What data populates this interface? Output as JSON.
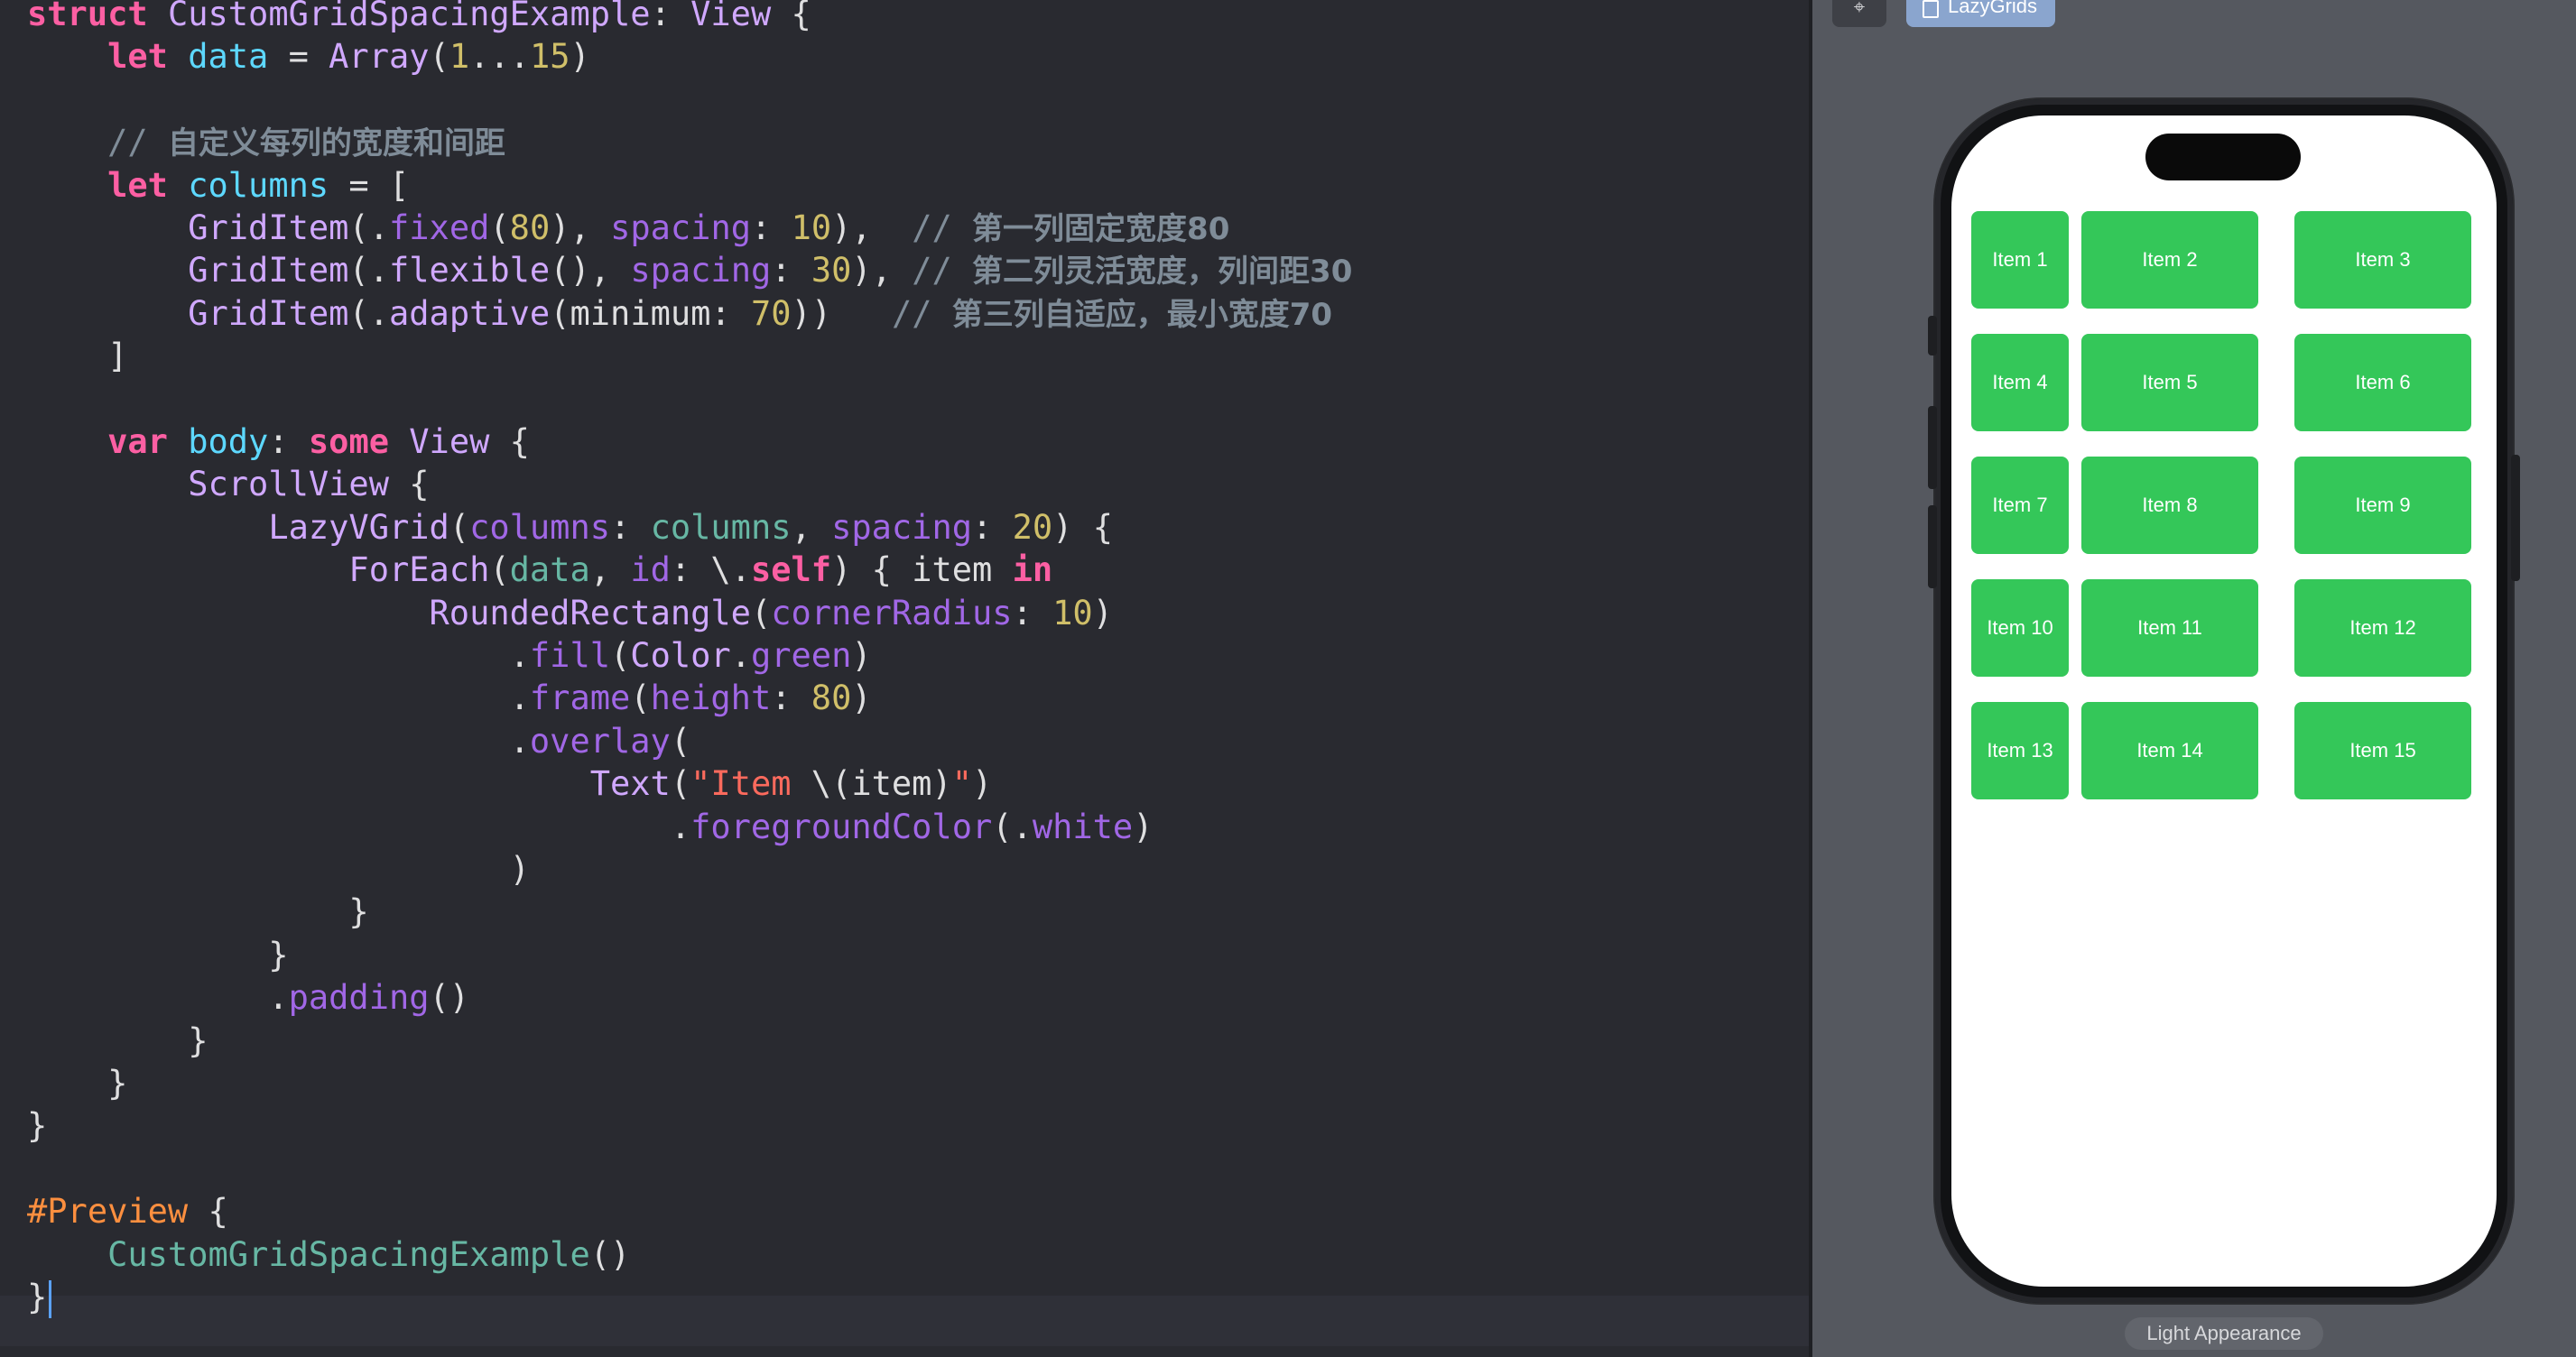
{
  "editor": {
    "lines": [
      [
        [
          "kw",
          "struct "
        ],
        [
          "type",
          "CustomGridSpacingExample"
        ],
        [
          "txt",
          ": "
        ],
        [
          "type",
          "View"
        ],
        [
          "txt",
          " {"
        ]
      ],
      [
        [
          "txt",
          "    "
        ],
        [
          "kw",
          "let "
        ],
        [
          "var",
          "data"
        ],
        [
          "txt",
          " = "
        ],
        [
          "type",
          "Array"
        ],
        [
          "txt",
          "("
        ],
        [
          "num",
          "1"
        ],
        [
          "txt",
          "..."
        ],
        [
          "num",
          "15"
        ],
        [
          "txt",
          ")"
        ]
      ],
      [],
      [
        [
          "txt",
          "    "
        ],
        [
          "cm",
          "// "
        ],
        [
          "cm cm-zh",
          "自定义每列的宽度和间距"
        ]
      ],
      [
        [
          "txt",
          "    "
        ],
        [
          "kw",
          "let "
        ],
        [
          "var",
          "columns"
        ],
        [
          "txt",
          " = ["
        ]
      ],
      [
        [
          "txt",
          "        "
        ],
        [
          "type",
          "GridItem"
        ],
        [
          "txt",
          "(."
        ],
        [
          "member",
          "fixed"
        ],
        [
          "txt",
          "("
        ],
        [
          "num",
          "80"
        ],
        [
          "txt",
          "), "
        ],
        [
          "member",
          "spacing"
        ],
        [
          "txt",
          ": "
        ],
        [
          "num",
          "10"
        ],
        [
          "txt",
          "),  "
        ],
        [
          "cm",
          "// "
        ],
        [
          "cm cm-zh",
          "第一列固定宽度80"
        ]
      ],
      [
        [
          "txt",
          "        "
        ],
        [
          "type",
          "GridItem"
        ],
        [
          "txt",
          "(."
        ],
        [
          "type",
          "flexible"
        ],
        [
          "txt",
          "(), "
        ],
        [
          "member",
          "spacing"
        ],
        [
          "txt",
          ": "
        ],
        [
          "num",
          "30"
        ],
        [
          "txt",
          "), "
        ],
        [
          "cm",
          "// "
        ],
        [
          "cm cm-zh",
          "第二列灵活宽度，列间距30"
        ]
      ],
      [
        [
          "txt",
          "        "
        ],
        [
          "type",
          "GridItem"
        ],
        [
          "txt",
          "(."
        ],
        [
          "type",
          "adaptive"
        ],
        [
          "txt",
          "(minimum: "
        ],
        [
          "num",
          "70"
        ],
        [
          "txt",
          "))   "
        ],
        [
          "cm",
          "// "
        ],
        [
          "cm cm-zh",
          "第三列自适应，最小宽度70"
        ]
      ],
      [
        [
          "txt",
          "    ]"
        ]
      ],
      [],
      [
        [
          "txt",
          "    "
        ],
        [
          "kw",
          "var "
        ],
        [
          "var",
          "body"
        ],
        [
          "txt",
          ": "
        ],
        [
          "kw",
          "some "
        ],
        [
          "type",
          "View"
        ],
        [
          "txt",
          " {"
        ]
      ],
      [
        [
          "txt",
          "        "
        ],
        [
          "type",
          "ScrollView"
        ],
        [
          "txt",
          " {"
        ]
      ],
      [
        [
          "txt",
          "            "
        ],
        [
          "type",
          "LazyVGrid"
        ],
        [
          "txt",
          "("
        ],
        [
          "member",
          "columns"
        ],
        [
          "txt",
          ": "
        ],
        [
          "prj",
          "columns"
        ],
        [
          "txt",
          ", "
        ],
        [
          "member",
          "spacing"
        ],
        [
          "txt",
          ": "
        ],
        [
          "num",
          "20"
        ],
        [
          "txt",
          ") {"
        ]
      ],
      [
        [
          "txt",
          "                "
        ],
        [
          "type",
          "ForEach"
        ],
        [
          "txt",
          "("
        ],
        [
          "prj",
          "data"
        ],
        [
          "txt",
          ", "
        ],
        [
          "member",
          "id"
        ],
        [
          "txt",
          ": \\."
        ],
        [
          "kw",
          "self"
        ],
        [
          "txt",
          ") { item "
        ],
        [
          "kw",
          "in"
        ]
      ],
      [
        [
          "txt",
          "                    "
        ],
        [
          "type",
          "RoundedRectangle"
        ],
        [
          "txt",
          "("
        ],
        [
          "member",
          "cornerRadius"
        ],
        [
          "txt",
          ": "
        ],
        [
          "num",
          "10"
        ],
        [
          "txt",
          ")"
        ]
      ],
      [
        [
          "txt",
          "                        ."
        ],
        [
          "member",
          "fill"
        ],
        [
          "txt",
          "("
        ],
        [
          "type",
          "Color"
        ],
        [
          "txt",
          "."
        ],
        [
          "member",
          "green"
        ],
        [
          "txt",
          ")"
        ]
      ],
      [
        [
          "txt",
          "                        ."
        ],
        [
          "member",
          "frame"
        ],
        [
          "txt",
          "("
        ],
        [
          "member",
          "height"
        ],
        [
          "txt",
          ": "
        ],
        [
          "num",
          "80"
        ],
        [
          "txt",
          ")"
        ]
      ],
      [
        [
          "txt",
          "                        ."
        ],
        [
          "member",
          "overlay"
        ],
        [
          "txt",
          "("
        ]
      ],
      [
        [
          "txt",
          "                            "
        ],
        [
          "type",
          "Text"
        ],
        [
          "txt",
          "("
        ],
        [
          "str",
          "\"Item "
        ],
        [
          "txt",
          "\\(item)"
        ],
        [
          "str",
          "\""
        ],
        [
          "txt",
          ")"
        ]
      ],
      [
        [
          "txt",
          "                                ."
        ],
        [
          "member",
          "foregroundColor"
        ],
        [
          "txt",
          "(."
        ],
        [
          "member",
          "white"
        ],
        [
          "txt",
          ")"
        ]
      ],
      [
        [
          "txt",
          "                        )"
        ]
      ],
      [
        [
          "txt",
          "                }"
        ]
      ],
      [
        [
          "txt",
          "            }"
        ]
      ],
      [
        [
          "txt",
          "            ."
        ],
        [
          "member",
          "padding"
        ],
        [
          "txt",
          "()"
        ]
      ],
      [
        [
          "txt",
          "        }"
        ]
      ],
      [
        [
          "txt",
          "    }"
        ]
      ],
      [
        [
          "txt",
          "}"
        ]
      ],
      [],
      [
        [
          "dir",
          "#Preview"
        ],
        [
          "txt",
          " {"
        ]
      ],
      [
        [
          "txt",
          "    "
        ],
        [
          "prj",
          "CustomGridSpacingExample"
        ],
        [
          "txt",
          "()"
        ]
      ],
      [
        [
          "txt",
          "}"
        ]
      ]
    ]
  },
  "canvas": {
    "pin_icon": "⌖",
    "pin_icon_name": "pin-icon",
    "preview_tab_label": "LazyGrids",
    "appearance_label": "Light Appearance",
    "grid_items": [
      "Item 1",
      "Item 2",
      "Item 3",
      "Item 4",
      "Item 5",
      "Item 6",
      "Item 7",
      "Item 8",
      "Item 9",
      "Item 10",
      "Item 11",
      "Item 12",
      "Item 13",
      "Item 14",
      "Item 15"
    ],
    "cell_color": "#34c759"
  }
}
